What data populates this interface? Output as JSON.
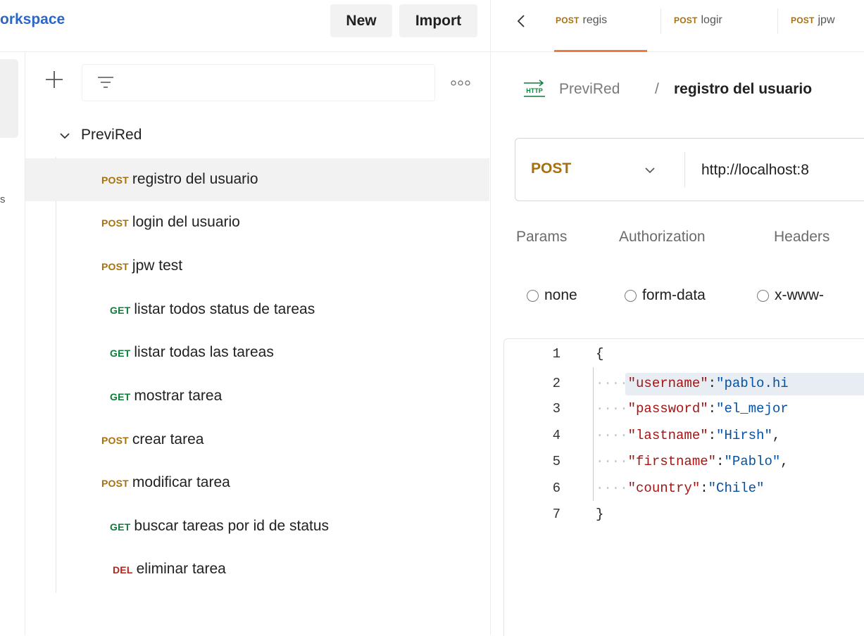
{
  "workspace": {
    "title": "orkspace",
    "new_label": "New",
    "import_label": "Import"
  },
  "rail": {
    "partial_label": "s"
  },
  "collection": {
    "name": "PreviRed",
    "requests": [
      {
        "method": "POST",
        "name": "registro del usuario",
        "selected": true
      },
      {
        "method": "POST",
        "name": "login del usuario"
      },
      {
        "method": "POST",
        "name": "jpw test"
      },
      {
        "method": "GET",
        "name": "listar todos status de tareas"
      },
      {
        "method": "GET",
        "name": "listar todas las tareas"
      },
      {
        "method": "GET",
        "name": "mostrar tarea"
      },
      {
        "method": "POST",
        "name": "crear tarea"
      },
      {
        "method": "POST",
        "name": "modificar tarea"
      },
      {
        "method": "GET",
        "name": "buscar tareas por id de status"
      },
      {
        "method": "DEL",
        "name": "eliminar tarea"
      }
    ]
  },
  "tabs": [
    {
      "method": "POST",
      "name": "regis"
    },
    {
      "method": "POST",
      "name": "logir"
    },
    {
      "method": "POST",
      "name": "jpw"
    }
  ],
  "breadcrumb": {
    "icon_text": "HTTP",
    "parent": "PreviRed",
    "separator": "/",
    "current": "registro del usuario"
  },
  "request": {
    "method": "POST",
    "url": "http://localhost:8"
  },
  "request_tabs": [
    "Params",
    "Authorization",
    "Headers"
  ],
  "body_types": [
    "none",
    "form-data",
    "x-www-"
  ],
  "editor": {
    "line_numbers": [
      "1",
      "2",
      "3",
      "4",
      "5",
      "6",
      "7"
    ],
    "lines": [
      {
        "text": "{"
      },
      {
        "indent": "····",
        "key": "\"username\"",
        "sep": ":",
        "value": "\"pablo.hi"
      },
      {
        "indent": "····",
        "key": "\"password\"",
        "sep": ":",
        "value": "\"el_mejor"
      },
      {
        "indent": "····",
        "key": "\"lastname\"",
        "sep": ":",
        "value": "\"Hirsh\"",
        "tail": ","
      },
      {
        "indent": "····",
        "key": "\"firstname\"",
        "sep": ":",
        "value": "\"Pablo\"",
        "tail": ","
      },
      {
        "indent": "····",
        "key": "\"country\"",
        "sep": ":",
        "value": "\"Chile\""
      },
      {
        "text": "}"
      }
    ]
  },
  "colors": {
    "post": "#a7700c",
    "get": "#0e7c3a",
    "del": "#b3261e",
    "accent": "#ee7a3f",
    "workspace_title": "#2b66c9"
  }
}
